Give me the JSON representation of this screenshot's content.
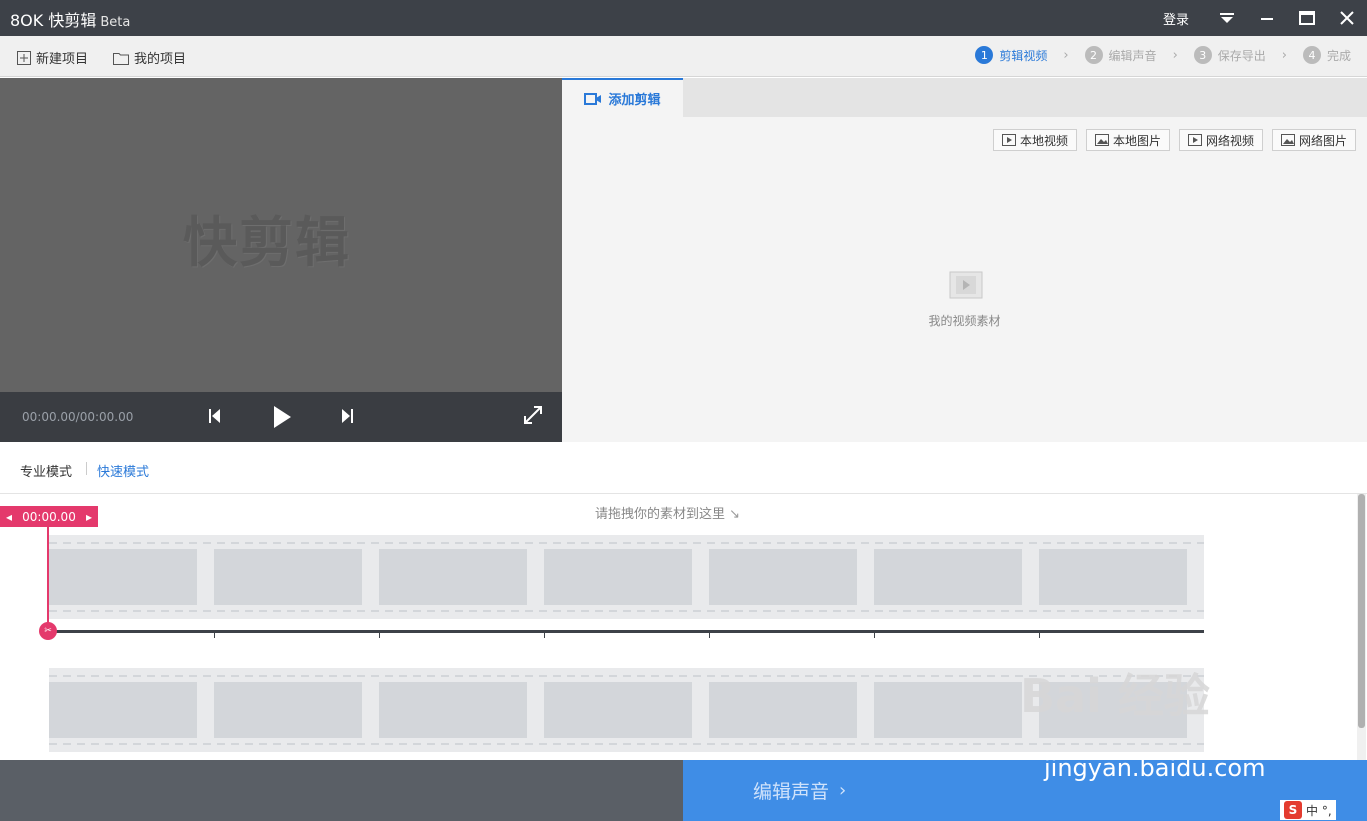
{
  "app": {
    "logo": "8OK 快剪辑",
    "beta": "Beta"
  },
  "titlebar": {
    "login": "登录"
  },
  "toolbar": {
    "new_project": "新建项目",
    "my_projects": "我的项目"
  },
  "steps": [
    {
      "num": "1",
      "label": "剪辑视频",
      "active": true
    },
    {
      "num": "2",
      "label": "编辑声音",
      "active": false
    },
    {
      "num": "3",
      "label": "保存导出",
      "active": false
    },
    {
      "num": "4",
      "label": "完成",
      "active": false
    }
  ],
  "preview": {
    "watermark": "快剪辑",
    "time": "00:00.00/00:00.00"
  },
  "clip_panel": {
    "tab_label": "添加剪辑",
    "sources": [
      "本地视频",
      "本地图片",
      "网络视频",
      "网络图片"
    ],
    "empty_text": "我的视频素材"
  },
  "modes": {
    "pro": "专业模式",
    "fast": "快速模式"
  },
  "timeline": {
    "hint": "请拖拽你的素材到这里",
    "playhead_time": "00:00.00"
  },
  "footer": {
    "next_button": "编辑声音"
  },
  "watermark": {
    "brand": "Bai 经验",
    "url": "jingyan.baidu.com"
  },
  "ime": {
    "label": "中 °,"
  },
  "colors": {
    "accent": "#2a79d8",
    "playhead": "#e4396c",
    "footer_button": "#3f8de6",
    "titlebar": "#3d4148"
  }
}
